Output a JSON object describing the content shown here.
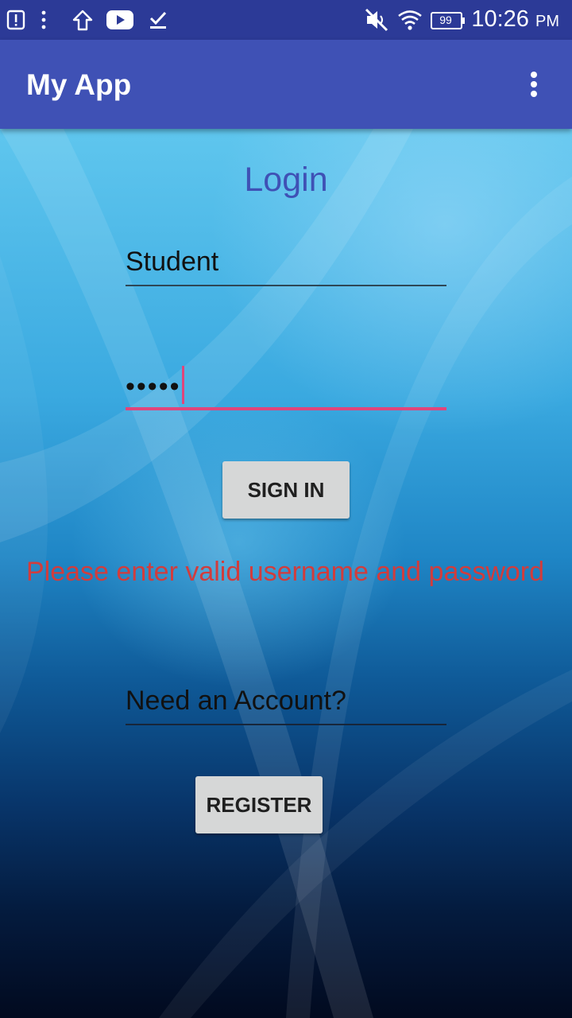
{
  "status_bar": {
    "icons": [
      "alert-icon",
      "more-vert-icon",
      "upload-icon",
      "youtube-icon",
      "download-done-icon",
      "mute-icon",
      "wifi-icon",
      "battery-icon"
    ],
    "battery": "99",
    "time": "10:26",
    "ampm": "PM"
  },
  "app_bar": {
    "title": "My App",
    "menu_icon": "overflow-menu-icon"
  },
  "login": {
    "title": "Login",
    "username_value": "Student",
    "password_value": "•••••",
    "sign_in_label": "SIGN IN",
    "error": "Please enter valid username and password",
    "need_account": "Need an Account?",
    "register_label": "REGISTER"
  },
  "colors": {
    "status_bar": "#2c3a97",
    "app_bar": "#3f51b5",
    "accent": "#e0457b",
    "error": "#d23c3c"
  }
}
